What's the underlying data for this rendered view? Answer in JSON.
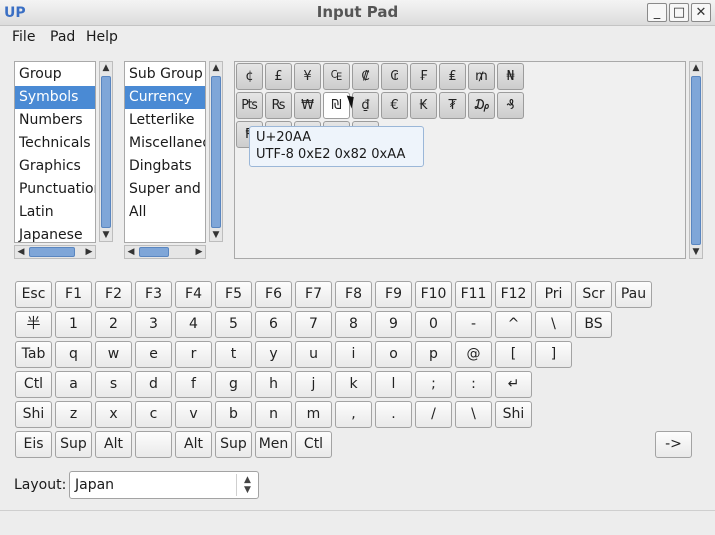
{
  "window": {
    "title": "Input Pad",
    "app_icon": "UP",
    "minimize": "_",
    "maximize": "□",
    "close": "✕"
  },
  "menu": [
    "File",
    "Pad",
    "Help"
  ],
  "group": {
    "header": "Group",
    "items": [
      "Symbols",
      "Numbers",
      "Technicals",
      "Graphics",
      "Punctuation",
      "Latin",
      "Japanese"
    ],
    "selected": "Symbols"
  },
  "subgroup": {
    "header": "Sub Group",
    "items": [
      "Currency",
      "Letterlike",
      "Miscellaneous",
      "Dingbats",
      "Super and Sub",
      "All"
    ],
    "selected": "Currency"
  },
  "chars_row1": [
    "¢",
    "£",
    "¥",
    "₠",
    "₡",
    "₢",
    "₣",
    "₤",
    "₥",
    "₦"
  ],
  "chars_row2": [
    "₧",
    "₨",
    "₩",
    "₪",
    "₫",
    "€",
    "₭",
    "₮",
    "₯",
    "₰"
  ],
  "chars_row3": [
    "₱",
    "₲",
    "₳",
    "₴",
    "₵"
  ],
  "tooltip": {
    "codepoint": "U+20AA",
    "utf8": "UTF-8 0xE2 0x82 0xAA"
  },
  "keyboard": {
    "row1": [
      "Esc",
      "F1",
      "F2",
      "F3",
      "F4",
      "F5",
      "F6",
      "F7",
      "F8",
      "F9",
      "F10",
      "F11",
      "F12",
      "Pri",
      "Scr",
      "Pau"
    ],
    "row2": [
      "半",
      "1",
      "2",
      "3",
      "4",
      "5",
      "6",
      "7",
      "8",
      "9",
      "0",
      "-",
      "^",
      "\\",
      "BS"
    ],
    "row3": [
      "Tab",
      "q",
      "w",
      "e",
      "r",
      "t",
      "y",
      "u",
      "i",
      "o",
      "p",
      "@",
      "[",
      "]"
    ],
    "row4": [
      "Ctl",
      "a",
      "s",
      "d",
      "f",
      "g",
      "h",
      "j",
      "k",
      "l",
      ";",
      ":",
      "↵"
    ],
    "row5": [
      "Shi",
      "z",
      "x",
      "c",
      "v",
      "b",
      "n",
      "m",
      ",",
      ".",
      "/",
      "\\",
      "Shi"
    ],
    "row6": [
      "Eis",
      "Sup",
      "Alt",
      "",
      "Alt",
      "Sup",
      "Men",
      "Ctl"
    ],
    "arrow": "->"
  },
  "layout": {
    "label": "Layout:",
    "value": "Japan"
  }
}
